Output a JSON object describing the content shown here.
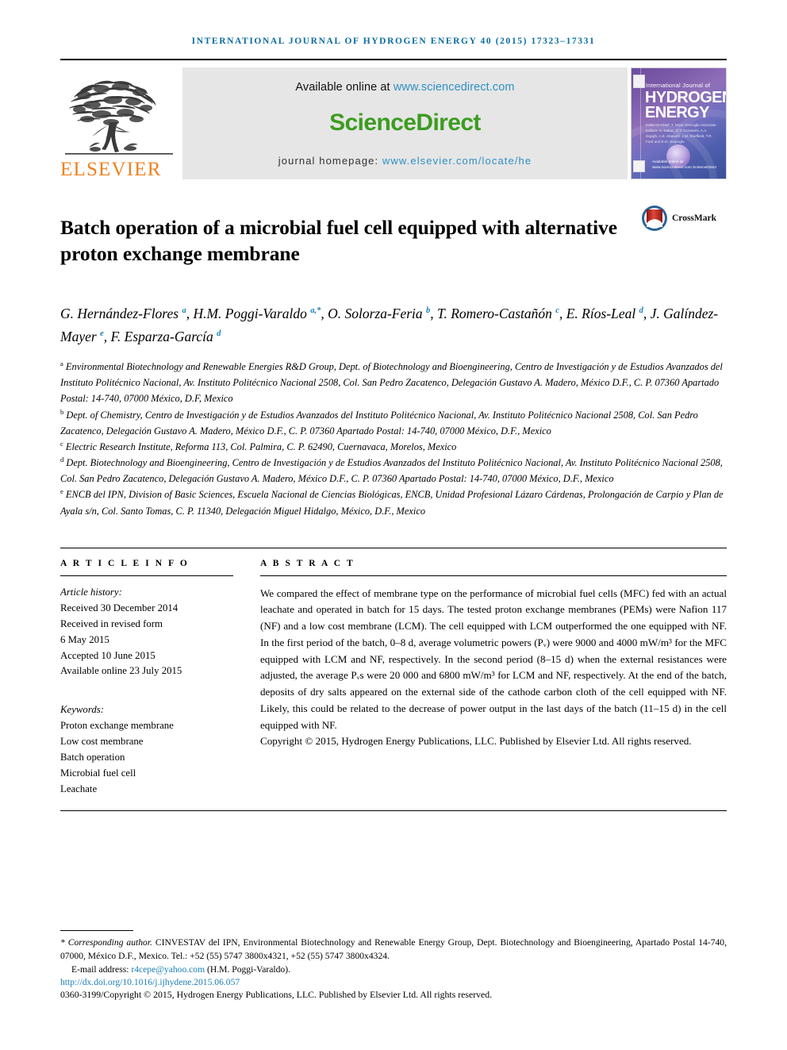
{
  "running_head": "INTERNATIONAL JOURNAL OF HYDROGEN ENERGY 40 (2015) 17323–17331",
  "masthead": {
    "publisher_wordmark": "ELSEVIER",
    "available_prefix": "Available online at ",
    "available_url": "www.sciencedirect.com",
    "sciencedirect_wordmark": "ScienceDirect",
    "homepage_prefix": "journal homepage: ",
    "homepage_url": "www.elsevier.com/locate/he",
    "cover": {
      "line_small": "International Journal of",
      "line_hydrogen": "HYDROGEN",
      "line_energy": "ENERGY",
      "editors": "Editor-in-Chief: T. Nejat Veziroglu\nAssociate Editors: S. Kakac, D.Y. Goswami, A.A. Sayigh, A.E. Abasahl, J.W. Sheffield, T.R. Ford and E.O. Serpoglu",
      "footer_brand": "Available online at www.sciencedirect.com\nScienceDirect"
    }
  },
  "title": "Batch operation of a microbial fuel cell equipped with alternative proton exchange membrane",
  "crossmark_label": "CrossMark",
  "authors": [
    {
      "name": "G. Hernández-Flores",
      "marks": "a",
      "sep": ", "
    },
    {
      "name": "H.M. Poggi-Varaldo",
      "marks": "a,*",
      "sep": ", "
    },
    {
      "name": "O. Solorza-Feria",
      "marks": "b",
      "sep": ", "
    },
    {
      "name": "T. Romero-Castañón",
      "marks": "c",
      "sep": ", "
    },
    {
      "name": "E. Ríos-Leal",
      "marks": "d",
      "sep": ", "
    },
    {
      "name": "J. Galíndez-Mayer",
      "marks": "e",
      "sep": ", "
    },
    {
      "name": "F. Esparza-García",
      "marks": "d",
      "sep": ""
    }
  ],
  "affiliations": [
    {
      "mark": "a",
      "text": "Environmental Biotechnology and Renewable Energies R&D Group, Dept. of Biotechnology and Bioengineering, Centro de Investigación y de Estudios Avanzados del Instituto Politécnico Nacional, Av. Instituto Politécnico Nacional 2508, Col. San Pedro Zacatenco, Delegación Gustavo A. Madero, México D.F., C. P. 07360 Apartado Postal: 14-740, 07000 México, D.F, Mexico"
    },
    {
      "mark": "b",
      "text": "Dept. of Chemistry, Centro de Investigación y de Estudios Avanzados del Instituto Politécnico Nacional, Av. Instituto Politécnico Nacional 2508, Col. San Pedro Zacatenco, Delegación Gustavo A. Madero, México D.F., C. P. 07360 Apartado Postal: 14-740, 07000 México, D.F., Mexico"
    },
    {
      "mark": "c",
      "text": "Electric Research Institute, Reforma 113, Col. Palmira, C. P. 62490, Cuernavaca, Morelos, Mexico"
    },
    {
      "mark": "d",
      "text": "Dept. Biotechnology and Bioengineering, Centro de Investigación y de Estudios Avanzados del Instituto Politécnico Nacional, Av. Instituto Politécnico Nacional 2508, Col. San Pedro Zacatenco, Delegación Gustavo A. Madero, México D.F., C. P. 07360 Apartado Postal: 14-740, 07000 México, D.F., Mexico"
    },
    {
      "mark": "e",
      "text": "ENCB del IPN, Division of Basic Sciences, Escuela Nacional de Ciencias Biológicas, ENCB, Unidad Profesional Lázaro Cárdenas, Prolongación de Carpio y Plan de Ayala s/n, Col. Santo Tomas, C. P. 11340, Delegación Miguel Hidalgo, México, D.F., Mexico"
    }
  ],
  "article_info": {
    "heading": "A R T I C L E  I N F O",
    "history_title": "Article history:",
    "history": [
      "Received 30 December 2014",
      "Received in revised form",
      "6 May 2015",
      "Accepted 10 June 2015",
      "Available online 23 July 2015"
    ],
    "keywords_title": "Keywords:",
    "keywords": [
      "Proton exchange membrane",
      "Low cost membrane",
      "Batch operation",
      "Microbial fuel cell",
      "Leachate"
    ]
  },
  "abstract": {
    "heading": "A B S T R A C T",
    "body": "We compared the effect of membrane type on the performance of microbial fuel cells (MFC) fed with an actual leachate and operated in batch for 15 days. The tested proton exchange membranes (PEMs) were Nafion 117 (NF) and a low cost membrane (LCM). The cell equipped with LCM outperformed the one equipped with NF. In the first period of the batch, 0–8 d, average volumetric powers (Pᵥ) were 9000 and 4000 mW/m³ for the MFC equipped with LCM and NF, respectively. In the second period (8–15 d) when the external resistances were adjusted, the average Pᵥs were 20 000 and 6800 mW/m³ for LCM and NF, respectively. At the end of the batch, deposits of dry salts appeared on the external side of the cathode carbon cloth of the cell equipped with NF. Likely, this could be related to the decrease of power output in the last days of the batch (11–15 d) in the cell equipped with NF.",
    "copyright": "Copyright © 2015, Hydrogen Energy Publications, LLC. Published by Elsevier Ltd. All rights reserved."
  },
  "footer": {
    "corresponding_lead": "* Corresponding author.",
    "corresponding_text": " CINVESTAV del IPN, Environmental Biotechnology and Renewable Energy Group, Dept. Biotechnology and Bioengineering, Apartado Postal 14-740, 07000, México D.F., Mexico. Tel.: +52 (55) 5747 3800x4321, +52 (55) 5747 3800x4324.",
    "email_label": "E-mail address: ",
    "email": "r4cepe@yahoo.com",
    "email_owner": " (H.M. Poggi-Varaldo).",
    "doi": "http://dx.doi.org/10.1016/j.ijhydene.2015.06.057",
    "issn_line": "0360-3199/Copyright © 2015, Hydrogen Energy Publications, LLC. Published by Elsevier Ltd. All rights reserved."
  },
  "colors": {
    "journal_blue": "#0a6ca0",
    "link_blue": "#2e8fc4",
    "sciencedirect_green": "#3c9c20",
    "elsevier_orange": "#F08120",
    "affiliation_mark_blue": "#1a7fb5"
  }
}
